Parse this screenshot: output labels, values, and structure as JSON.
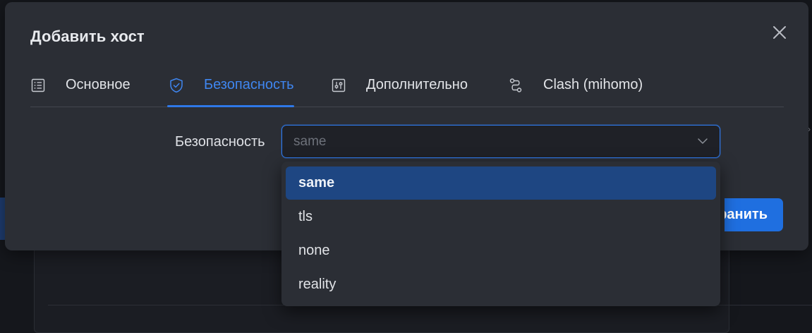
{
  "modal": {
    "title": "Добавить хост"
  },
  "tabs": [
    {
      "label": "Основное",
      "icon": "list-icon",
      "active": false
    },
    {
      "label": "Безопасность",
      "icon": "shield-icon",
      "active": true
    },
    {
      "label": "Дополнительно",
      "icon": "sliders-icon",
      "active": false
    },
    {
      "label": "Clash (mihomo)",
      "icon": "route-icon",
      "active": false
    }
  ],
  "security_field": {
    "label": "Безопасность",
    "value": "same"
  },
  "dropdown": {
    "options": [
      "same",
      "tls",
      "none",
      "reality"
    ],
    "selected": "same"
  },
  "actions": {
    "save_label_visible": "ранить"
  },
  "colors": {
    "accent": "#2f78e8",
    "modal_bg": "#2b2e35",
    "selected_option_bg": "#1e4682"
  }
}
